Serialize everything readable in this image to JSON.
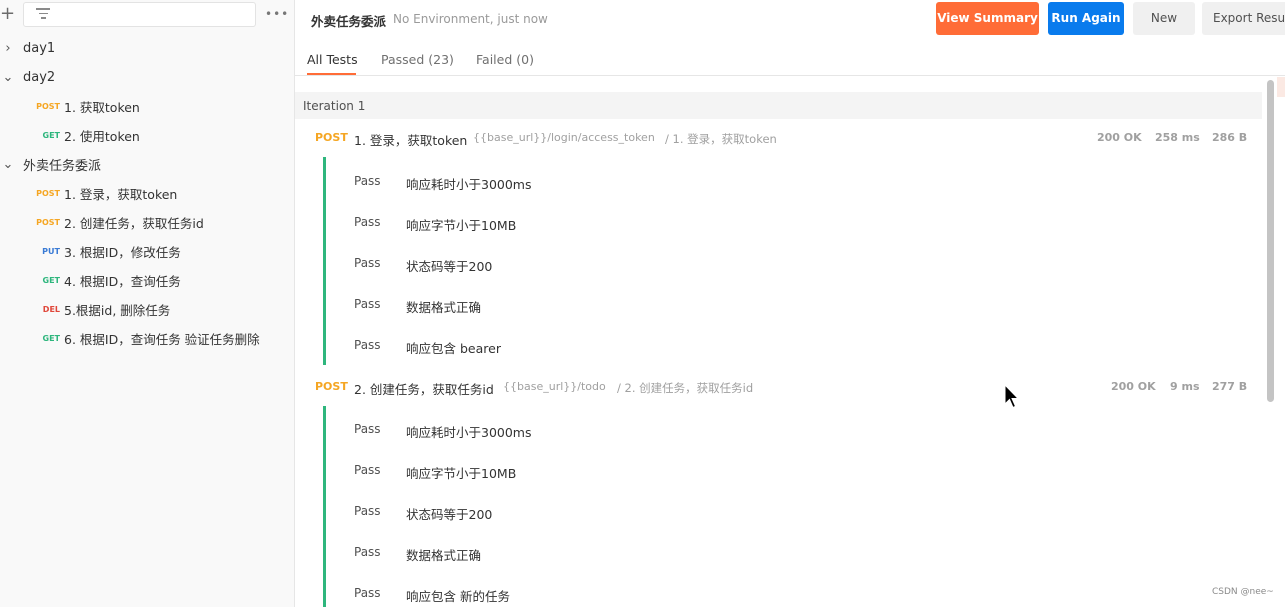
{
  "sidebar": {
    "new_icon": "+",
    "filter_icon": "filter-icon",
    "more_icon": "•••",
    "items": [
      {
        "type": "folder",
        "chevron": "›",
        "label": "day1"
      },
      {
        "type": "folder",
        "chevron": "⌄",
        "label": "day2"
      },
      {
        "type": "request",
        "method": "POST",
        "label": "1. 获取token"
      },
      {
        "type": "request",
        "method": "GET",
        "label": "2. 使用token"
      },
      {
        "type": "folder",
        "chevron": "⌄",
        "label": "外卖任务委派"
      },
      {
        "type": "request",
        "method": "POST",
        "label": "1. 登录，获取token"
      },
      {
        "type": "request",
        "method": "POST",
        "label": "2. 创建任务，获取任务id"
      },
      {
        "type": "request",
        "method": "PUT",
        "label": "3. 根据ID，修改任务"
      },
      {
        "type": "request",
        "method": "GET",
        "label": "4. 根据ID，查询任务"
      },
      {
        "type": "request",
        "method": "DEL",
        "label": "5.根据id, 删除任务"
      },
      {
        "type": "request",
        "method": "GET",
        "label": "6. 根据ID，查询任务 验证任务删除"
      }
    ]
  },
  "header": {
    "title": "外卖任务委派",
    "meta": "No Environment, just now",
    "buttons": {
      "view_summary": "View Summary",
      "run_again": "Run Again",
      "new": "New",
      "export": "Export Results"
    }
  },
  "tabs": {
    "all": "All Tests",
    "passed": "Passed (23)",
    "failed": "Failed (0)"
  },
  "iteration": {
    "label": "Iteration 1",
    "requests": [
      {
        "method": "POST",
        "name": "1. 登录，获取token",
        "url": "{{base_url}}/login/access_token",
        "path": "/ 1. 登录，获取token",
        "status": "200 OK",
        "time": "258 ms",
        "size": "286 B",
        "tests": [
          {
            "status": "Pass",
            "name": "响应耗时小于3000ms"
          },
          {
            "status": "Pass",
            "name": "响应字节小于10MB"
          },
          {
            "status": "Pass",
            "name": "状态码等于200"
          },
          {
            "status": "Pass",
            "name": "数据格式正确"
          },
          {
            "status": "Pass",
            "name": "响应包含 bearer"
          }
        ]
      },
      {
        "method": "POST",
        "name": "2. 创建任务，获取任务id",
        "url": "{{base_url}}/todo",
        "path": "/ 2. 创建任务，获取任务id",
        "status": "200 OK",
        "time": "9 ms",
        "size": "277 B",
        "tests": [
          {
            "status": "Pass",
            "name": "响应耗时小于3000ms"
          },
          {
            "status": "Pass",
            "name": "响应字节小于10MB"
          },
          {
            "status": "Pass",
            "name": "状态码等于200"
          },
          {
            "status": "Pass",
            "name": "数据格式正确"
          },
          {
            "status": "Pass",
            "name": "响应包含 新的任务"
          }
        ]
      }
    ]
  },
  "watermark": "CSDN @nee~",
  "colors": {
    "accent_orange": "#ff6c37",
    "primary_blue": "#097bed",
    "pass_green": "#2eb67d",
    "post": "#f5a623",
    "get": "#2eb67d",
    "put": "#3a7bd5",
    "del": "#e0473a"
  }
}
